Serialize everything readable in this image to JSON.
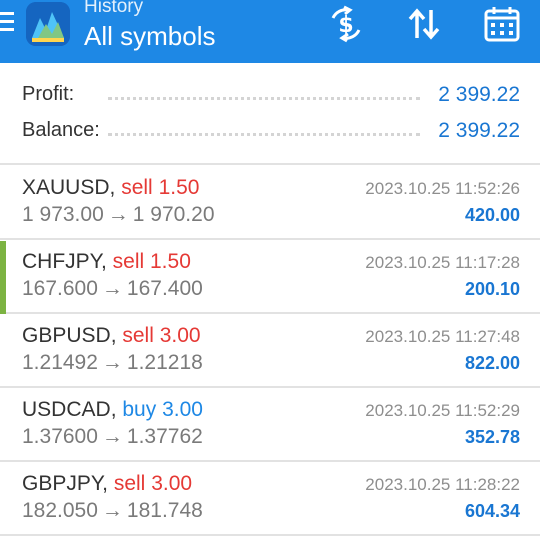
{
  "header": {
    "subtitle": "History",
    "title": "All symbols",
    "icons": [
      "menu-icon",
      "app-logo",
      "currency-exchange-icon",
      "sort-icon",
      "calendar-icon"
    ],
    "background": "#1e88e5"
  },
  "summary": {
    "profit_label": "Profit:",
    "profit_value": "2 399.22",
    "balance_label": "Balance:",
    "balance_value": "2 399.22"
  },
  "colors": {
    "accent": "#1976d2",
    "sell": "#e53935",
    "buy": "#1e88e5",
    "selected_marker": "#7cb342"
  },
  "trades": [
    {
      "symbol": "XAUUSD",
      "side": "sell",
      "volume": "1.50",
      "open": "1 973.00",
      "close": "1 970.20",
      "time": "2023.10.25 11:52:26",
      "profit": "420.00"
    },
    {
      "symbol": "CHFJPY",
      "side": "sell",
      "volume": "1.50",
      "open": "167.600",
      "close": "167.400",
      "time": "2023.10.25 11:17:28",
      "profit": "200.10",
      "selected": true
    },
    {
      "symbol": "GBPUSD",
      "side": "sell",
      "volume": "3.00",
      "open": "1.21492",
      "close": "1.21218",
      "time": "2023.10.25 11:27:48",
      "profit": "822.00"
    },
    {
      "symbol": "USDCAD",
      "side": "buy",
      "volume": "3.00",
      "open": "1.37600",
      "close": "1.37762",
      "time": "2023.10.25 11:52:29",
      "profit": "352.78"
    },
    {
      "symbol": "GBPJPY",
      "side": "sell",
      "volume": "3.00",
      "open": "182.050",
      "close": "181.748",
      "time": "2023.10.25 11:28:22",
      "profit": "604.34"
    }
  ]
}
